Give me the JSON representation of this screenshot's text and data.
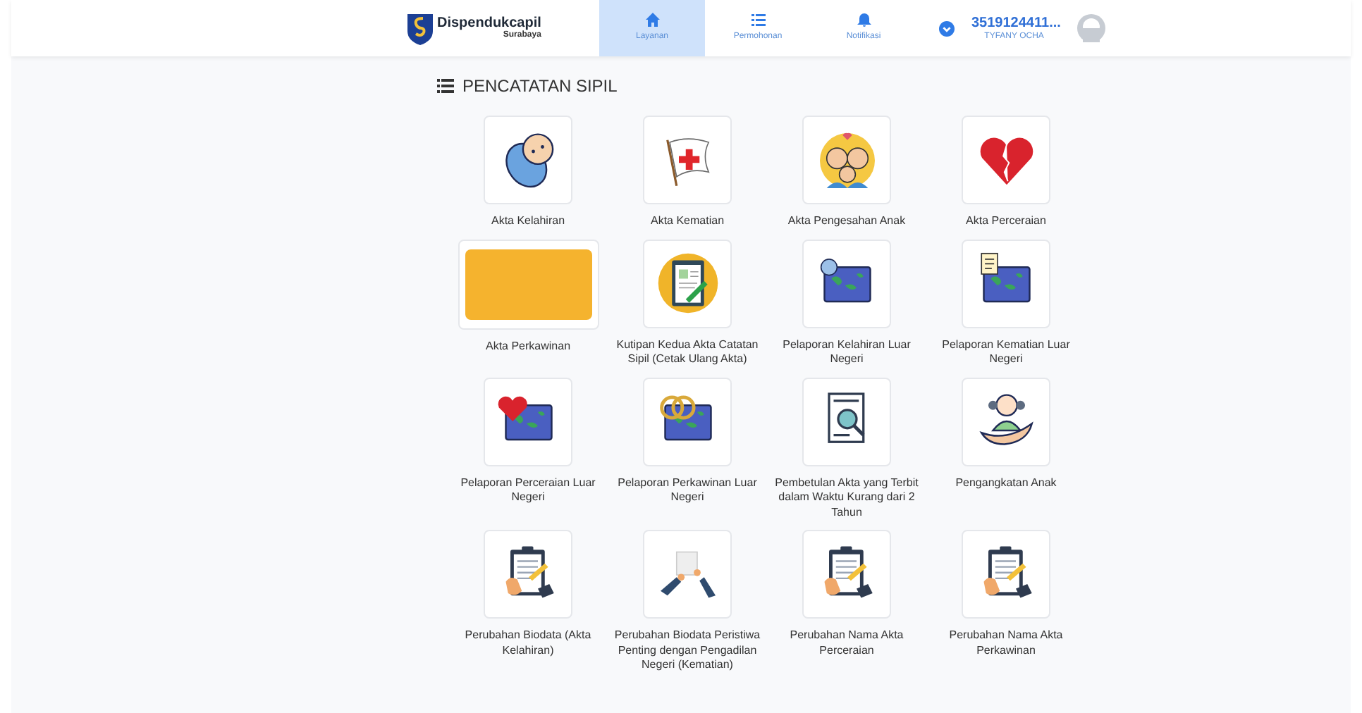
{
  "header": {
    "brand": {
      "name": "Dispendukcapil",
      "city": "Surabaya"
    },
    "nav": [
      {
        "label": "Layanan",
        "selected": true
      },
      {
        "label": "Permohonan",
        "selected": false
      },
      {
        "label": "Notifikasi",
        "selected": false
      }
    ],
    "user": {
      "id": "3519124411...",
      "name": "TYFANY OCHA"
    }
  },
  "section": {
    "title": "PENCATATAN SIPIL",
    "services": [
      {
        "label": "Akta Kelahiran"
      },
      {
        "label": "Akta Kematian"
      },
      {
        "label": "Akta Pengesahan Anak"
      },
      {
        "label": "Akta Perceraian"
      },
      {
        "label": "Akta Perkawinan"
      },
      {
        "label": "Kutipan Kedua Akta Catatan Sipil (Cetak Ulang Akta)"
      },
      {
        "label": "Pelaporan Kelahiran Luar Negeri"
      },
      {
        "label": "Pelaporan Kematian Luar Negeri"
      },
      {
        "label": "Pelaporan Perceraian Luar Negeri"
      },
      {
        "label": "Pelaporan Perkawinan Luar Negeri"
      },
      {
        "label": "Pembetulan Akta yang Terbit dalam Waktu Kurang dari 2 Tahun"
      },
      {
        "label": "Pengangkatan Anak"
      },
      {
        "label": "Perubahan Biodata (Akta Kelahiran)"
      },
      {
        "label": "Perubahan Biodata Peristiwa Penting dengan Pengadilan Negeri (Kematian)"
      },
      {
        "label": "Perubahan Nama Akta Perceraian"
      },
      {
        "label": "Perubahan Nama Akta Perkawinan"
      }
    ]
  }
}
